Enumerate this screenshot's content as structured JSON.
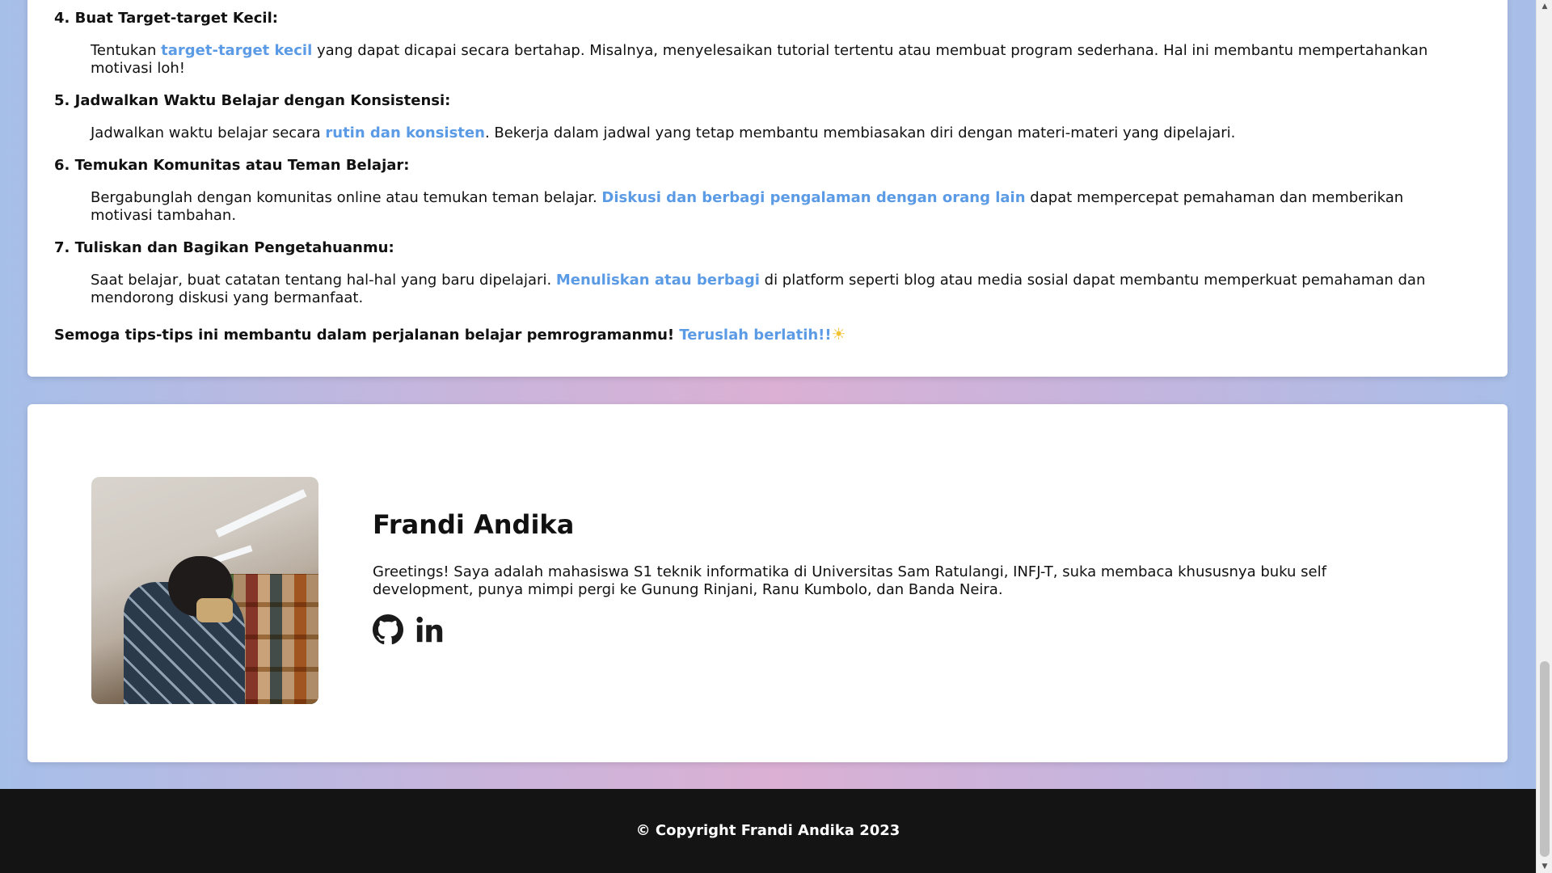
{
  "article": {
    "tips": [
      {
        "heading": "4. Buat Target-target Kecil:",
        "before": "Tentukan ",
        "link": "target-target kecil",
        "after": " yang dapat dicapai secara bertahap. Misalnya, menyelesaikan tutorial tertentu atau membuat program sederhana. Hal ini membantu mempertahankan motivasi loh!"
      },
      {
        "heading": "5. Jadwalkan Waktu Belajar dengan Konsistensi:",
        "before": "Jadwalkan waktu belajar secara ",
        "link": "rutin dan konsisten",
        "after": ". Bekerja dalam jadwal yang tetap membantu membiasakan diri dengan materi-materi yang dipelajari."
      },
      {
        "heading": "6. Temukan Komunitas atau Teman Belajar:",
        "before": "Bergabunglah dengan komunitas online atau temukan teman belajar. ",
        "link": "Diskusi dan berbagi pengalaman dengan orang lain",
        "after": " dapat mempercepat pemahaman dan memberikan motivasi tambahan."
      },
      {
        "heading": "7. Tuliskan dan Bagikan Pengetahuanmu:",
        "before": "Saat belajar, buat catatan tentang hal-hal yang baru dipelajari. ",
        "link": "Menuliskan atau berbagi",
        "after": " di platform seperti blog atau media sosial dapat membantu memperkuat pemahaman dan mendorong diskusi yang bermanfaat."
      }
    ],
    "closing_text": "Semoga tips-tips ini membantu dalam perjalanan belajar pemrogramanmu! ",
    "closing_link": "Teruslah berlatih!!",
    "closing_emoji": "☀"
  },
  "author": {
    "name": "Frandi Andika",
    "bio": "Greetings! Saya adalah mahasiswa S1 teknik informatika di Universitas Sam Ratulangi, INFJ-T, suka membaca khususnya buku self development, punya mimpi pergi ke Gunung Rinjani, Ranu Kumbolo, dan Banda Neira.",
    "social_icons": [
      "github-icon",
      "linkedin-icon"
    ]
  },
  "footer": {
    "copyright": "© Copyright Frandi Andika 2023"
  },
  "colors": {
    "link": "#5b9be6",
    "footer_bg": "#141414",
    "card_bg": "#ffffff"
  }
}
